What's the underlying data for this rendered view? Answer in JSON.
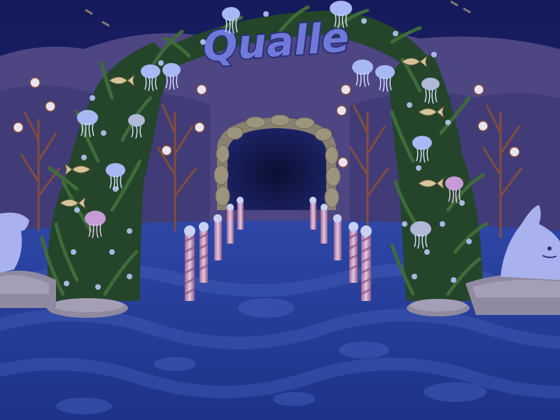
{
  "scene": {
    "sign_text": "Qualle"
  },
  "colors": {
    "sky_top": "#141a5a",
    "sky_bottom": "#2a2f86",
    "rock": "#4d4682",
    "rock_dark": "#3a346c",
    "floor_light": "#3d57b6",
    "floor_dark": "#233a8e",
    "cave_dark": "#0c1138",
    "arch_stone": "#8a8270",
    "sign_fill": "#6f7ad8",
    "sign_outline": "#2b2f7a",
    "seaweed": "#2b4f2f",
    "seaweed_light": "#3e6b3a",
    "jellyfish": "#a8b8f4",
    "jellyfish_pink": "#c79bd6",
    "pole_pink": "#c48ab0",
    "pole_white": "#e8d8ee",
    "coral": "#9a5a3a",
    "seal": "#a9b2ee",
    "stone_base": "#8f8aa0",
    "fish": "#d6c49a"
  }
}
